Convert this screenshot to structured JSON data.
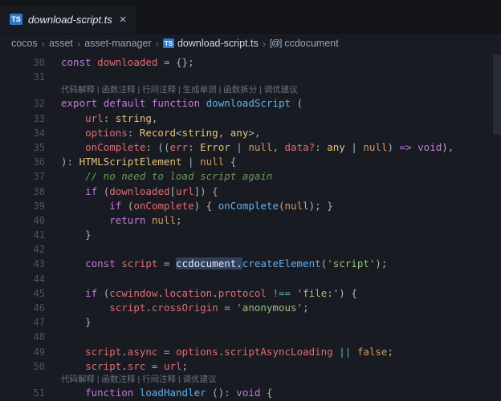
{
  "tab": {
    "badge": "TS",
    "title": "download-script.ts",
    "close_glyph": "×"
  },
  "breadcrumb": {
    "separator": "›",
    "items": [
      {
        "label": "cocos"
      },
      {
        "label": "asset"
      },
      {
        "label": "asset-manager"
      },
      {
        "label": "download-script.ts",
        "icon": "TS"
      },
      {
        "label": "ccdocument",
        "icon": "[@]"
      }
    ]
  },
  "editor": {
    "lines": [
      {
        "num": "30",
        "tokens": [
          [
            "kw",
            "const"
          ],
          [
            "pln",
            " "
          ],
          [
            "var",
            "downloaded"
          ],
          [
            "pln",
            " = {};"
          ]
        ]
      },
      {
        "num": "31",
        "tokens": []
      },
      {
        "codelens": "代码解释 | 函数注释 | 行间注释 | 生成单测 | 函数拆分 | 调优建议"
      },
      {
        "num": "32",
        "tokens": [
          [
            "kw",
            "export"
          ],
          [
            "pln",
            " "
          ],
          [
            "kw",
            "default"
          ],
          [
            "pln",
            " "
          ],
          [
            "kw",
            "function"
          ],
          [
            "pln",
            " "
          ],
          [
            "fn",
            "downloadScript"
          ],
          [
            "pln",
            " ("
          ]
        ]
      },
      {
        "num": "33",
        "tokens": [
          [
            "pln",
            "    "
          ],
          [
            "var",
            "url"
          ],
          [
            "pln",
            ": "
          ],
          [
            "type",
            "string"
          ],
          [
            "pln",
            ","
          ]
        ]
      },
      {
        "num": "34",
        "tokens": [
          [
            "pln",
            "    "
          ],
          [
            "var",
            "options"
          ],
          [
            "pln",
            ": "
          ],
          [
            "type",
            "Record"
          ],
          [
            "pln",
            "<"
          ],
          [
            "type",
            "string"
          ],
          [
            "pln",
            ", "
          ],
          [
            "type",
            "any"
          ],
          [
            "pln",
            ">,"
          ]
        ]
      },
      {
        "num": "35",
        "tokens": [
          [
            "pln",
            "    "
          ],
          [
            "var",
            "onComplete"
          ],
          [
            "pln",
            ": (("
          ],
          [
            "var",
            "err"
          ],
          [
            "pln",
            ": "
          ],
          [
            "type",
            "Error"
          ],
          [
            "pln",
            " | "
          ],
          [
            "const",
            "null"
          ],
          [
            "pln",
            ", "
          ],
          [
            "var",
            "data?"
          ],
          [
            "pln",
            ": "
          ],
          [
            "type",
            "any"
          ],
          [
            "pln",
            " | "
          ],
          [
            "const",
            "null"
          ],
          [
            "pln",
            ") "
          ],
          [
            "kw",
            "=>"
          ],
          [
            "pln",
            " "
          ],
          [
            "kw",
            "void"
          ],
          [
            "pln",
            "),"
          ]
        ]
      },
      {
        "num": "36",
        "tokens": [
          [
            "pln",
            "): "
          ],
          [
            "type",
            "HTMLScriptElement"
          ],
          [
            "pln",
            " | "
          ],
          [
            "const",
            "null"
          ],
          [
            "pln",
            " {"
          ]
        ]
      },
      {
        "num": "37",
        "tokens": [
          [
            "pln",
            "    "
          ],
          [
            "cm",
            "// no need to load script again"
          ]
        ]
      },
      {
        "num": "38",
        "tokens": [
          [
            "pln",
            "    "
          ],
          [
            "kw",
            "if"
          ],
          [
            "pln",
            " ("
          ],
          [
            "var",
            "downloaded"
          ],
          [
            "pln",
            "["
          ],
          [
            "var",
            "url"
          ],
          [
            "pln",
            "]) {"
          ]
        ]
      },
      {
        "num": "39",
        "tokens": [
          [
            "pln",
            "        "
          ],
          [
            "kw",
            "if"
          ],
          [
            "pln",
            " ("
          ],
          [
            "var",
            "onComplete"
          ],
          [
            "pln",
            ") { "
          ],
          [
            "fn",
            "onComplete"
          ],
          [
            "pln",
            "("
          ],
          [
            "const",
            "null"
          ],
          [
            "pln",
            "); }"
          ]
        ]
      },
      {
        "num": "40",
        "tokens": [
          [
            "pln",
            "        "
          ],
          [
            "kw",
            "return"
          ],
          [
            "pln",
            " "
          ],
          [
            "const",
            "null"
          ],
          [
            "pln",
            ";"
          ]
        ]
      },
      {
        "num": "41",
        "tokens": [
          [
            "pln",
            "    }"
          ]
        ]
      },
      {
        "num": "42",
        "tokens": []
      },
      {
        "num": "43",
        "tokens": [
          [
            "pln",
            "    "
          ],
          [
            "kw",
            "const"
          ],
          [
            "pln",
            " "
          ],
          [
            "var",
            "script"
          ],
          [
            "pln",
            " = "
          ],
          [
            "hl",
            "ccdocument."
          ],
          [
            "fn",
            "createElement"
          ],
          [
            "pln",
            "("
          ],
          [
            "str",
            "'script'"
          ],
          [
            "pln",
            ");"
          ]
        ]
      },
      {
        "num": "44",
        "tokens": []
      },
      {
        "num": "45",
        "tokens": [
          [
            "pln",
            "    "
          ],
          [
            "kw",
            "if"
          ],
          [
            "pln",
            " ("
          ],
          [
            "var",
            "ccwindow"
          ],
          [
            "pln",
            "."
          ],
          [
            "var",
            "location"
          ],
          [
            "pln",
            "."
          ],
          [
            "var",
            "protocol"
          ],
          [
            "pln",
            " "
          ],
          [
            "op",
            "!=="
          ],
          [
            "pln",
            " "
          ],
          [
            "str",
            "'file:'"
          ],
          [
            "pln",
            ") {"
          ]
        ]
      },
      {
        "num": "46",
        "tokens": [
          [
            "pln",
            "        "
          ],
          [
            "var",
            "script"
          ],
          [
            "pln",
            "."
          ],
          [
            "var",
            "crossOrigin"
          ],
          [
            "pln",
            " = "
          ],
          [
            "str",
            "'anonymous'"
          ],
          [
            "pln",
            ";"
          ]
        ]
      },
      {
        "num": "47",
        "tokens": [
          [
            "pln",
            "    }"
          ]
        ]
      },
      {
        "num": "48",
        "tokens": []
      },
      {
        "num": "49",
        "tokens": [
          [
            "pln",
            "    "
          ],
          [
            "var",
            "script"
          ],
          [
            "pln",
            "."
          ],
          [
            "var",
            "async"
          ],
          [
            "pln",
            " = "
          ],
          [
            "var",
            "options"
          ],
          [
            "pln",
            "."
          ],
          [
            "var",
            "scriptAsyncLoading"
          ],
          [
            "pln",
            " "
          ],
          [
            "op",
            "||"
          ],
          [
            "pln",
            " "
          ],
          [
            "const",
            "false"
          ],
          [
            "pln",
            ";"
          ]
        ]
      },
      {
        "num": "50",
        "tokens": [
          [
            "pln",
            "    "
          ],
          [
            "var",
            "script"
          ],
          [
            "pln",
            "."
          ],
          [
            "var",
            "src"
          ],
          [
            "pln",
            " = "
          ],
          [
            "var",
            "url"
          ],
          [
            "pln",
            ";"
          ]
        ]
      },
      {
        "codelens": "代码解释 | 函数注释 | 行间注释 | 调优建议"
      },
      {
        "num": "51",
        "tokens": [
          [
            "pln",
            "    "
          ],
          [
            "kw",
            "function"
          ],
          [
            "pln",
            " "
          ],
          [
            "fn",
            "loadHandler"
          ],
          [
            "pln",
            " (): "
          ],
          [
            "kw",
            "void"
          ],
          [
            "pln",
            " {"
          ]
        ]
      }
    ]
  },
  "colors": {
    "editor_bg": "#181b21",
    "tabbar_bg": "#131519",
    "keyword": "#c678dd",
    "function": "#61afef",
    "variable": "#e06c75",
    "type": "#e5c07b",
    "string": "#98c379",
    "constant": "#d19a66",
    "operator": "#56b6c2",
    "comment": "#6a9955",
    "text": "#abb2bf",
    "line_number": "#4c5464",
    "highlight_bg": "#30415f",
    "ts_badge_bg": "#3178c6"
  }
}
